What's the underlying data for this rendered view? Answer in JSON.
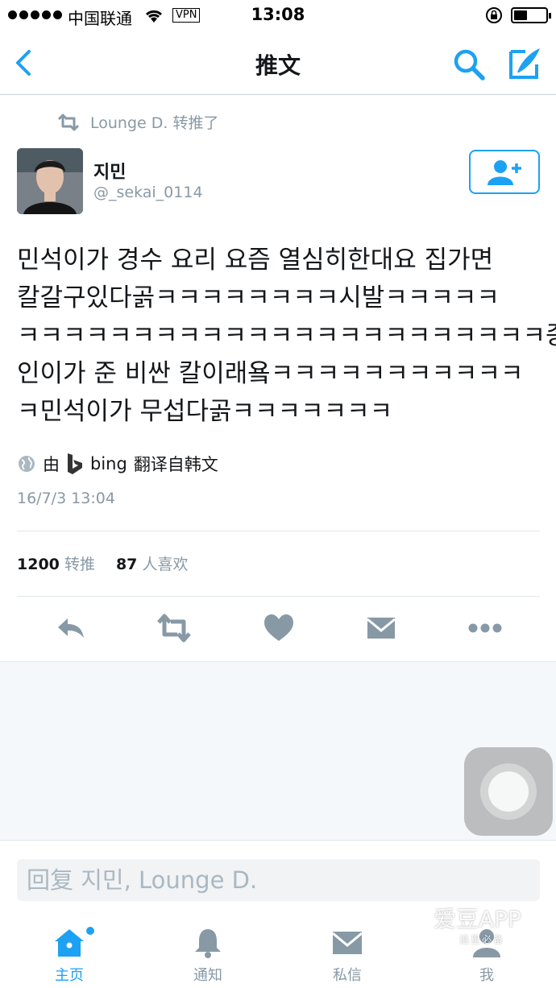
{
  "status_bar": {
    "carrier": "中国联通",
    "vpn": "VPN",
    "time": "13:08"
  },
  "nav": {
    "title": "推文"
  },
  "retweet": {
    "text": "Lounge D. 转推了"
  },
  "author": {
    "name": "지민",
    "handle": "@_sekai_0114"
  },
  "tweet": {
    "lines": [
      "민석이가 경수 요리 요즘 열심히한대요 집가면",
      "칼갈구있다곩ㅋㅋㅋㅋㅋㅋㅋㅋ시발ㅋㅋㅋㅋㅋ",
      "ㅋㅋㅋㅋㅋㅋㅋㅋㅋㅋㅋㅋㅋㅋㅋㅋㅋㅋㅋㅋㅋㅋㅋ종",
      "인이가 준 비싼 칼이래욬ㅋㅋㅋㅋㅋㅋㅋㅋㅋㅋㅋ",
      "ㅋ민석이가 무섭다곩ㅋㅋㅋㅋㅋㅋㅋ"
    ],
    "translate_prefix": "由",
    "translate_brand": "bing",
    "translate_suffix": "翻译自韩文",
    "timestamp": "16/7/3 13:04"
  },
  "stats": {
    "retweets_count": "1200",
    "retweets_label": "转推",
    "likes_count": "87",
    "likes_label": "人喜欢"
  },
  "reply": {
    "placeholder": "回复 지민, Lounge D."
  },
  "tabs": [
    {
      "label": "主页",
      "icon": "home-icon",
      "active": true
    },
    {
      "label": "通知",
      "icon": "bell-icon",
      "active": false
    },
    {
      "label": "私信",
      "icon": "envelope-icon",
      "active": false
    },
    {
      "label": "我",
      "icon": "person-icon",
      "active": false
    }
  ],
  "watermark": {
    "title": "爱豆APP",
    "subtitle": "追星必备"
  },
  "colors": {
    "accent": "#1da1f2",
    "secondary_text": "#8899a6",
    "action_icon": "#8899a6"
  }
}
